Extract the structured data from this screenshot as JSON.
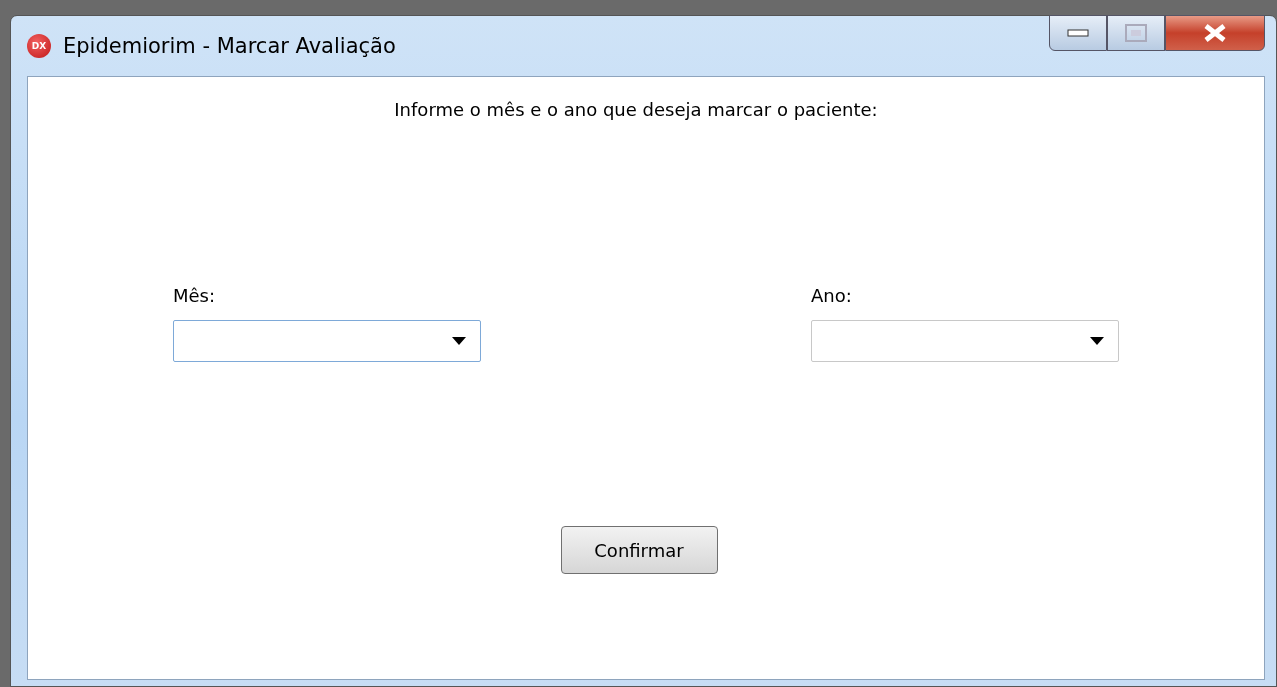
{
  "window": {
    "title": "Epidemiorim - Marcar Avaliação",
    "app_icon": "DX"
  },
  "instruction": "Informe o mês e o ano que deseja marcar o paciente:",
  "fields": [
    {
      "label": "Mês:",
      "focused": true
    },
    {
      "label": "Ano:",
      "focused": false
    }
  ],
  "buttons": [
    "Confirmar"
  ]
}
